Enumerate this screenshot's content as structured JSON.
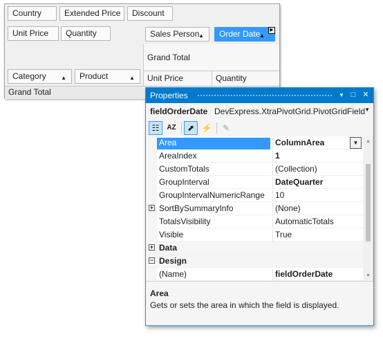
{
  "pivot": {
    "filter_fields": [
      "Country",
      "Extended Price",
      "Discount"
    ],
    "data_fields": [
      "Unit Price",
      "Quantity"
    ],
    "column_fields": [
      {
        "label": "Sales Person",
        "sort": "▲"
      },
      {
        "label": "Order Date",
        "sort": "▲"
      }
    ],
    "row_fields": [
      {
        "label": "Category",
        "sort": "▲"
      },
      {
        "label": "Product",
        "sort": "▲"
      }
    ],
    "column_grand_total": "Grand Total",
    "data_headers": [
      "Unit Price",
      "Quantity"
    ],
    "row_grand_total": "Grand Total"
  },
  "properties_window": {
    "title": "Properties",
    "controls": {
      "dropdown": "▼",
      "maximize": "□",
      "close": "✕"
    },
    "object_name": "fieldOrderDate",
    "object_type": "DevExpress.XtraPivotGrid.PivotGridField",
    "toolbar": {
      "categorized_glyph": "☷",
      "alphabetical_glyph": "↓",
      "properties_glyph": "⬈",
      "events_glyph": "⚡",
      "property_pages_glyph": "✎"
    },
    "rows": [
      {
        "name": "Area",
        "value": "ColumnArea",
        "bold": true,
        "selected": true
      },
      {
        "name": "AreaIndex",
        "value": "1",
        "bold": true
      },
      {
        "name": "CustomTotals",
        "value": "(Collection)",
        "bold": false
      },
      {
        "name": "GroupInterval",
        "value": "DateQuarter",
        "bold": true
      },
      {
        "name": "GroupIntervalNumericRange",
        "value": "10",
        "bold": false
      },
      {
        "name": "SortBySummaryInfo",
        "value": "(None)",
        "bold": false,
        "expander": "+"
      },
      {
        "name": "TotalsVisibility",
        "value": "AutomaticTotals",
        "bold": false
      },
      {
        "name": "Visible",
        "value": "True",
        "bold": false
      },
      {
        "name": "Data",
        "value": "",
        "category": true,
        "expander": "+"
      },
      {
        "name": "Design",
        "value": "",
        "category": true,
        "expander": "−"
      },
      {
        "name": "(Name)",
        "value": "fieldOrderDate",
        "bold": true
      }
    ],
    "description": {
      "title": "Area",
      "text": "Gets or sets the area in which the field is displayed."
    }
  }
}
